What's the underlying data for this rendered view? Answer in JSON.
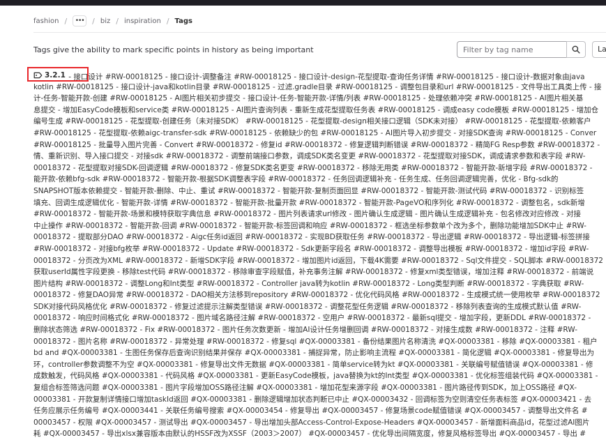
{
  "breadcrumb": {
    "items": [
      "fashion",
      "biz",
      "inspiration"
    ],
    "more_label": "•••",
    "current": "Tags"
  },
  "page": {
    "description": "Tags give the ability to mark specific points in history as being important"
  },
  "filter": {
    "placeholder": "Filter by tag name",
    "value": ""
  },
  "sort": {
    "label": "La"
  },
  "tag": {
    "name": "3.2.1"
  },
  "release_lines": [
    " - 接口设计 #RW-00018125 - 接口设计-调整备注 #RW-00018125 - 接口设计-design-花型提取-查询任务详情 #RW-00018125 - 接口设计-数据对象由java",
    "kotlin #RW-00018125 - 接口设计-java和kotlin目录 #RW-00018125 - 过滤.gradle目录 #RW-00018125 - 调整包目录和url #RW-00018125 - 文件导出工具类上传 - 接",
    "计-任务-智能开款-创建 #RW-00018125 - AI图片相关初步提交 - 接口设计-任务-智能开款-详情/列表 #RW-00018125 - 处理依赖冲突 #RW-00018125 - AI图片相关基",
    "息提交 - 增加EasyCode模板和service类 #RW-00018125 - AI图片查询列表 - 重新生成花型提取任务表 #RW-00018125 - 调成easy code模板 #RW-00018125 - 增加仓",
    "编号生成 #RW-00018125 - 花型提取-创建任务（未对接SDK） #RW-00018125 - 花型提取-design相关接口逻辑（SDK未对接） #RW-00018125 - 花型提取-依赖客户",
    "#RW-00018125 - 花型提取-依赖aigc-transfer-sdk #RW-00018125 - 依赖缺少的包 #RW-00018125 - AI图片导入初步提交 - 对接SDK查询 #RW-00018125 - Conver",
    "#RW-00018125 - 批量导入图片完善 - Convert #RW-00018372 - 修复id #RW-00018372 - 修复逻辑判断错误 #RW-00018372 - 精简FG Resp参数 #RW-00018372 -",
    "情、重新识别、导入接口提交 - 对接sdk #RW-00018372 - 调整前端接口参数，调成SDK类名变更 #RW-00018372 - 花型提取对接SDK，调成请求参数和表字段 #RW-",
    "00018372 - 花型提取对接SDK-回调逻辑 #RW-00018372 - 修复SDK类名更变 #RW-00018372 - 移除无用类 #RW-00018372 - 智能开款-新增字段 #RW-00018372 -",
    "能开款-依赖bfg-sdk #RW-00018372 - 智能开款-根据SDK调整表字段 #RW-00018372 - 任务回调逻辑补充 - 任务生成、任务回调逻辑完善，优化 - Bfg-sdk的",
    "SNAPSHOT版本依赖提交 - 智能开款-删除、中止、重试 #RW-00018372 - 智能开款-复制页面回显 #RW-00018372 - 智能开款-测试代码 #RW-00018372 - 识别标签",
    "填充、回调生成逻辑优化 - 智能开款-详情 #RW-00018372 - 智能开款-批量开款 #RW-00018372 - 智能开款-PageVO和序列化 #RW-00018372 - 调整包名，sdk新增",
    "#RW-00018372 - 智能开款-场景和模特获取字典信息 #RW-00018372 - 图片列表请求url修改 - 图片确认生成逻辑 - 图片确认生成逻辑补充 - 包名修改对应修改 - 对接",
    "中止操作 #RW-00018372 - 智能开款-回调 #RW-00018372 - 智能开款-标签回调和响应 #RW-00018372 - 框选坐标参数单个改为多个，删除功能增加SDK中止 #RW-",
    "00018372 - 提取部分DAO #RW-00018372 - Aigc任务id返回 #RW-00018372 - 实现BD获取任务 #RW-00018372 - 导出逻辑 #RW-00018372 - 导出逻辑-标签拼接",
    "#RW-00018372 - 对接bfg枚举 #RW-00018372 - Update #RW-00018372 - Sdk更新字段名 #RW-00018372 - 调整导出模板 #RW-00018372 - 增加id字段 #RW-",
    "00018372 - 分页改为XML #RW-00018372 - 新增SDK字段 #RW-00018372 - 增加图片id返回，下载4K需要 #RW-00018372 - Sql文件提交 - SQL脚本 #RW-00018372",
    "获取userId属性字段更换 - 移除test代码 #RW-00018372 - 移除审查字段赋值，补充事务注解 #RW-00018372 - 修复xml类型错误，增加注释 #RW-00018372 - 前端说",
    "图片结构 #RW-00018372 - 调整Long和Int类型 #RW-00018372 - Controller java转为kotlin #RW-00018372 - Long类型判断 #RW-00018372 - 字典获取 #RW-",
    "00018372 - 修复DAO异常 #RW-00018372 - DAO相关方法移到repository #RW-00018372 - 优化代码风格 #RW-00018372 - 生成模式统一使用枚举 #RW-00018372",
    "SDK对接代码风格优化 #RW-00018372 - 修复过滤提示注解类型错误 #RW-00018372 - 调整花型任务逻辑 #RW-00018372 - 移除列表查询的生成模式默认值 #RW-",
    "00018372 - 响应时间格式化 #RW-00018372 - 图片域名路径注解 #RW-00018372 - 空用户 #RW-00018372 - 最新sql提交 - 增加字段，更新DDL #RW-00018372 -",
    "删除状态筛选 #RW-00018372 - Fix #RW-00018372 - 图片任务次数更新 - 增加AI设计任务增删回调 #RW-00018372 - 对接生成数 #RW-00018372 - 注释 #RW-",
    "00018372 - 图片名称 #RW-00018372 - 异常处理 #RW-00018372 - 修复sql #QX-00003381 - 备份结果图片名称清洗 #QX-00003381 - 移除 #QX-00003381 - 租户",
    "bd and #QX-00003381 - 生图任务保存后查询识别结果并保存 #QX-00003381 - 捕捉异常，防止影响主流程 #QX-00003381 - 简化逻辑 #QX-00003381 - 修复导出为",
    "环，controller参数调整不为空 #QX-00003381 - 修复导出文件无数据 #QX-00003381 - 简单service转为kt #QX-00003381 - 关联编号赋值错误 #QX-00003381 - 修",
    "成数触发，代码风格 #QX-00003381 - 代码风格 #QX-00003381 - 更新EasyCode模板，java替换为kt的Int类型 #QX-00003381 - 优化标签组装代码 #QX-00003381 -",
    "复组合标签筛选问题 #QX-00003381 - 图片字段增加OSS路径注解 #QX-00003381 - 增加花型来源字段 #QX-00003381 - 图片路径传到SDK，加上OSS路径 #QX-",
    "00003381 - 开款复制详情接口增加taskId返回 #QX-00003381 - 删除逻辑增加状态判断已中止 #QX-00003432 - 回调标签为空则清空任务表标签 #QX-00003421 - 去",
    "任务应展示任务编号 #QX-00003441 - 关联任务编号搜索 #QX-00003454 - 修复导出 #QX-00003457 - 修复场景code赋值错误 #QX-00003457 - 调整导出文件名 #",
    "00003457 - 权限 #QX-00003457 - 测试导出 #QX-00003457 - 导出增加头部Access-Control-Expose-Headers #QX-00003457 - 新增面料商品id，花型过滤AI图片",
    "耗 #QX-00003457 - 导出xlsx兼容版本由默认的HSSF改为XSSF（2003＞2007） #QX-00003457 - 优化导出间隔宽度，修复风格标签导出 #QX-00003457 - 导出 #"
  ]
}
